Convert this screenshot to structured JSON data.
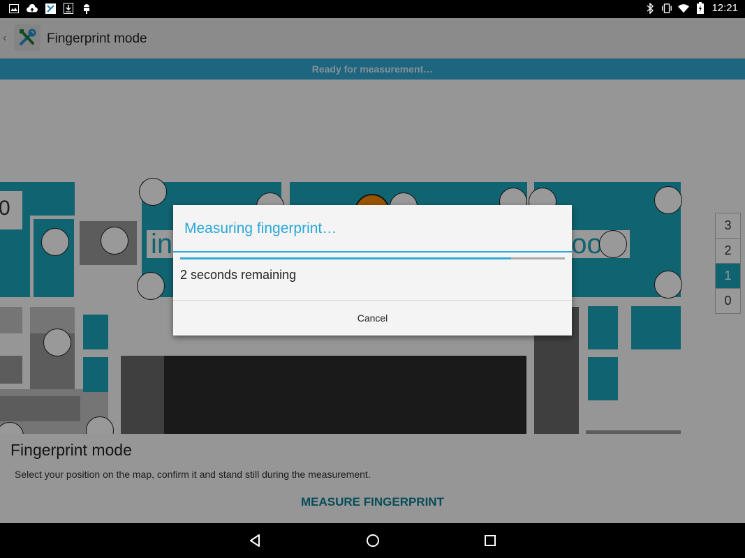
{
  "status_bar": {
    "time": "12:21",
    "left_icons": [
      "image-icon",
      "cloud-upload-icon",
      "app-notification-icon",
      "download-icon",
      "android-debug-icon"
    ],
    "right_icons": [
      "bluetooth-icon",
      "vibrate-icon",
      "wifi-icon",
      "battery-icon"
    ]
  },
  "action_bar": {
    "title": "Fingerprint mode",
    "icon": "tools-icon"
  },
  "banner": {
    "text": "Ready for measurement…"
  },
  "map": {
    "floors": [
      "3",
      "2",
      "1",
      "0"
    ],
    "active_floor": "1",
    "logo_left_fragment": "in",
    "logo_right_fragment": "doors",
    "sign_fragment": "0"
  },
  "bottom_panel": {
    "title": "Fingerprint mode",
    "description": "Select your position on the map, confirm it and stand still during the measurement.",
    "button_label": "MEASURE FINGERPRINT"
  },
  "dialog": {
    "title": "Measuring fingerprint…",
    "progress": 0.86,
    "message": "2 seconds remaining",
    "cancel_label": "Cancel"
  },
  "nav_bar": {
    "icons": [
      "back-icon",
      "home-icon",
      "recents-icon"
    ]
  },
  "colors": {
    "accent": "#33a8d6",
    "map_teal": "#1ca6bd",
    "marker": "#ff8a00"
  }
}
